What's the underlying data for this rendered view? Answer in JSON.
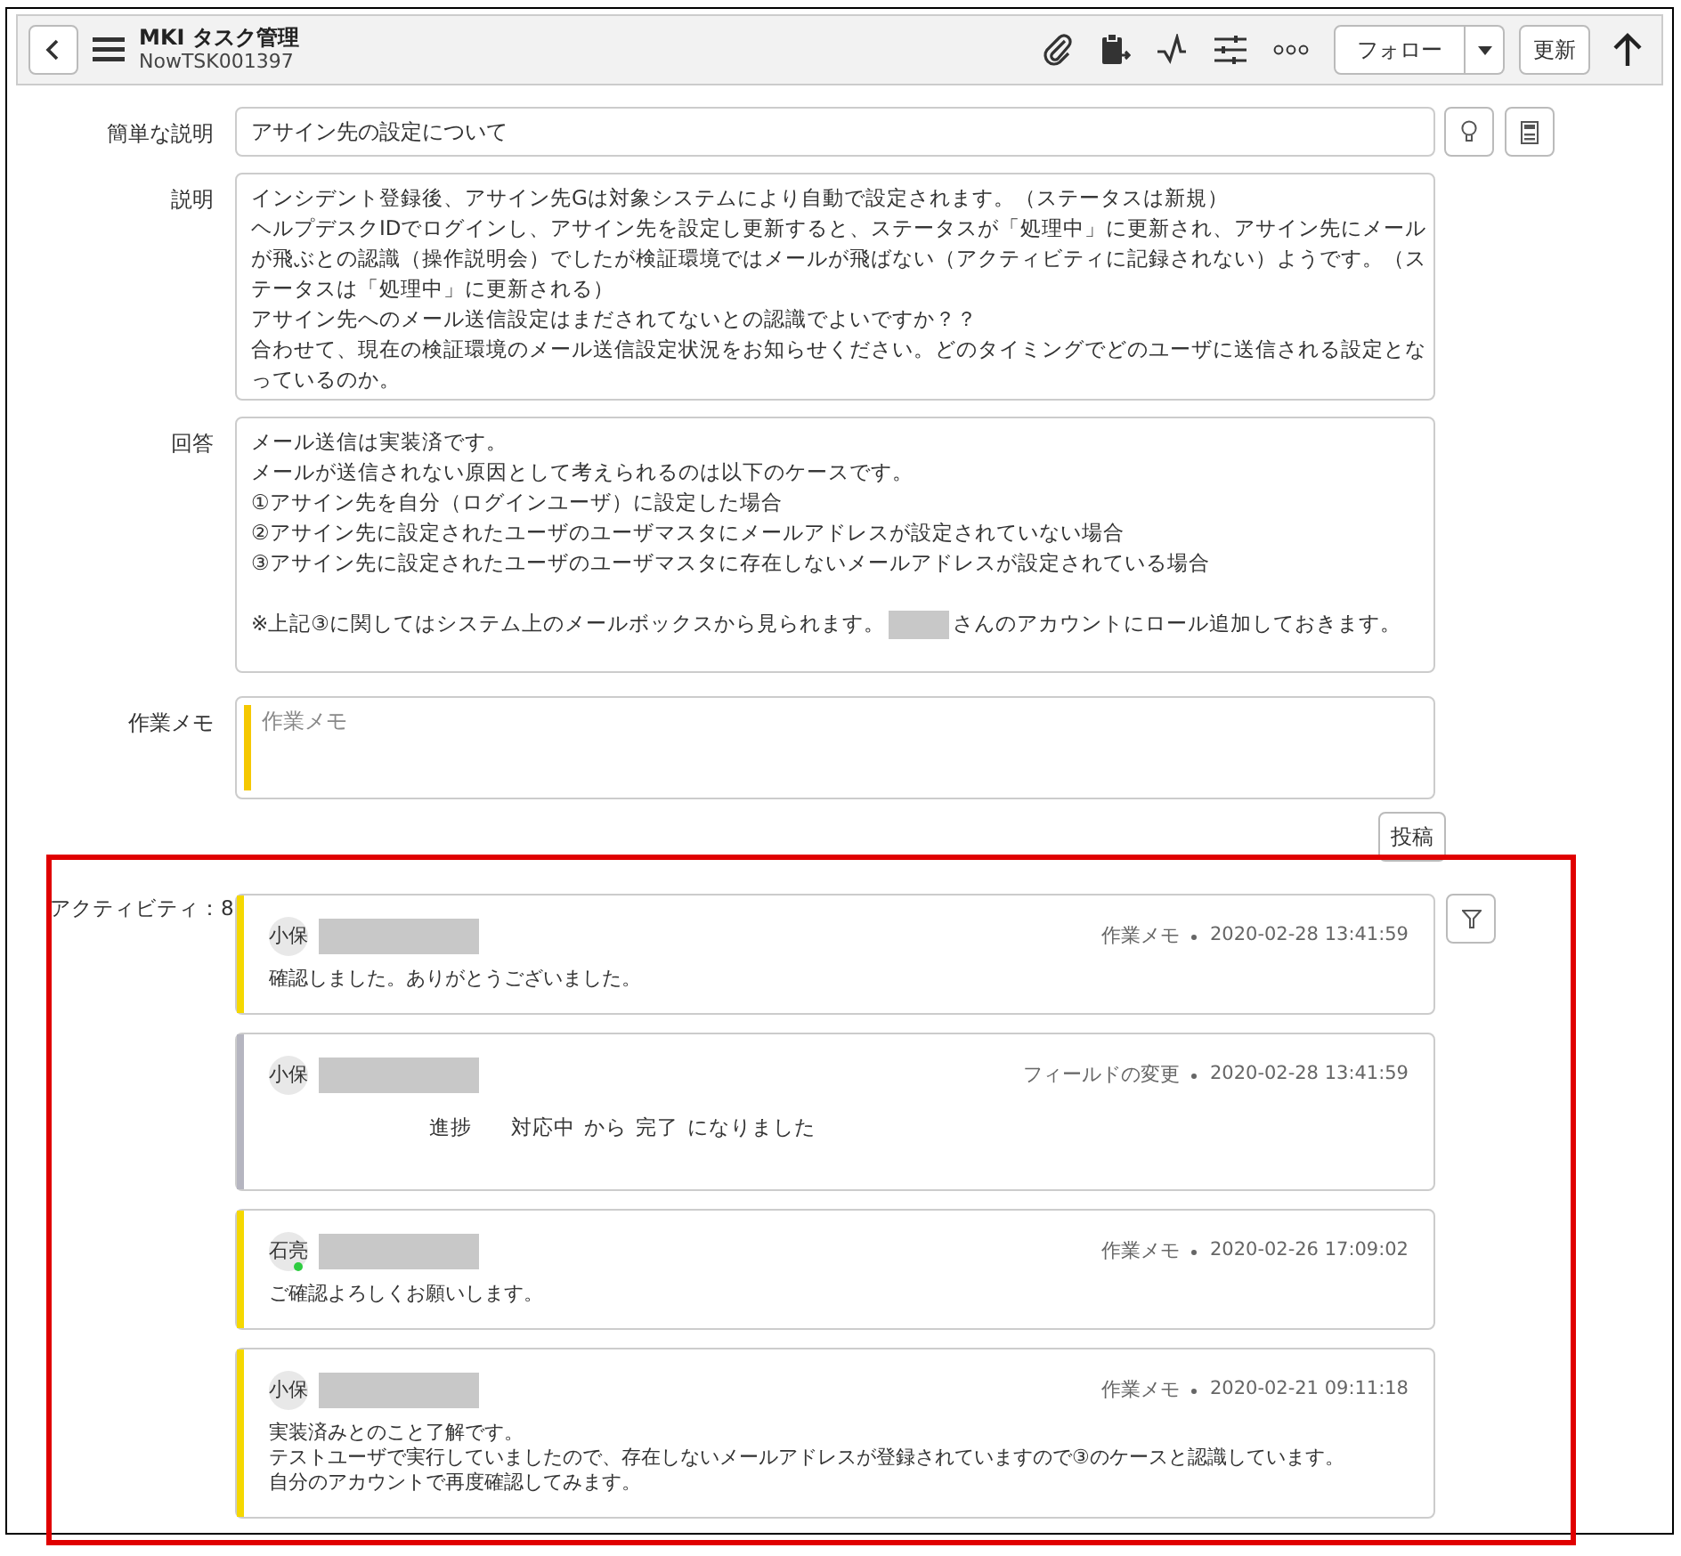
{
  "header": {
    "title": "MKI タスク管理",
    "record_number": "NowTSK001397",
    "follow_button": "フォロー",
    "update_button": "更新"
  },
  "form": {
    "short_description": {
      "label": "簡単な説明",
      "value": "アサイン先の設定について"
    },
    "description": {
      "label": "説明",
      "lines": [
        "インシデント登録後、アサイン先Gは対象システムにより自動で設定されます。（ステータスは新規）",
        "ヘルプデスクIDでログインし、アサイン先を設定し更新すると、ステータスが「処理中」に更新され、アサイン先にメール",
        "が飛ぶとの認識（操作説明会）でしたが検証環境ではメールが飛ばない（アクティビティに記録されない）ようです。（ス",
        "テータスは「処理中」に更新される）",
        "アサイン先へのメール送信設定はまだされてないとの認識でよいですか？？",
        "合わせて、現在の検証環境のメール送信設定状況をお知らせください。どのタイミングでどのユーザに送信される設定とな",
        "っているのか。"
      ]
    },
    "answer": {
      "label": "回答",
      "lines": [
        "メール送信は実装済です。",
        "メールが送信されない原因として考えられるのは以下のケースです。",
        "①アサイン先を自分（ログインユーザ）に設定した場合",
        "②アサイン先に設定されたユーザのユーザマスタにメールアドレスが設定されていない場合",
        "③アサイン先に設定されたユーザのユーザマスタに存在しないメールアドレスが設定されている場合"
      ],
      "note_before": "※上記③に関してはシステム上のメールボックスから見られます。",
      "note_after": "さんのアカウントにロール追加しておきます。"
    },
    "work_note": {
      "label": "作業メモ",
      "placeholder": "作業メモ"
    },
    "post_button": "投稿"
  },
  "activity": {
    "label": "アクティビティ：8",
    "entries": [
      {
        "kind": "note",
        "avatar": "小保",
        "online": false,
        "type": "作業メモ",
        "time": "2020-02-28 13:41:59",
        "lines": [
          "確認しました。ありがとうございました。"
        ]
      },
      {
        "kind": "field_change",
        "avatar": "小保",
        "online": false,
        "type": "フィールドの変更",
        "time": "2020-02-28 13:41:59",
        "field": "進捗",
        "from": "対応中",
        "from_word": "から",
        "to": "完了",
        "to_word": "になりました"
      },
      {
        "kind": "note",
        "avatar": "石亮",
        "online": true,
        "type": "作業メモ",
        "time": "2020-02-26 17:09:02",
        "lines": [
          "ご確認よろしくお願いします。"
        ]
      },
      {
        "kind": "note",
        "avatar": "小保",
        "online": false,
        "type": "作業メモ",
        "time": "2020-02-21 09:11:18",
        "lines": [
          "実装済みとのこと了解です。",
          "テストユーザで実行していましたので、存在しないメールアドレスが登録されていますので③のケースと認識しています。",
          "自分のアカウントで再度確認してみます。"
        ]
      }
    ]
  }
}
